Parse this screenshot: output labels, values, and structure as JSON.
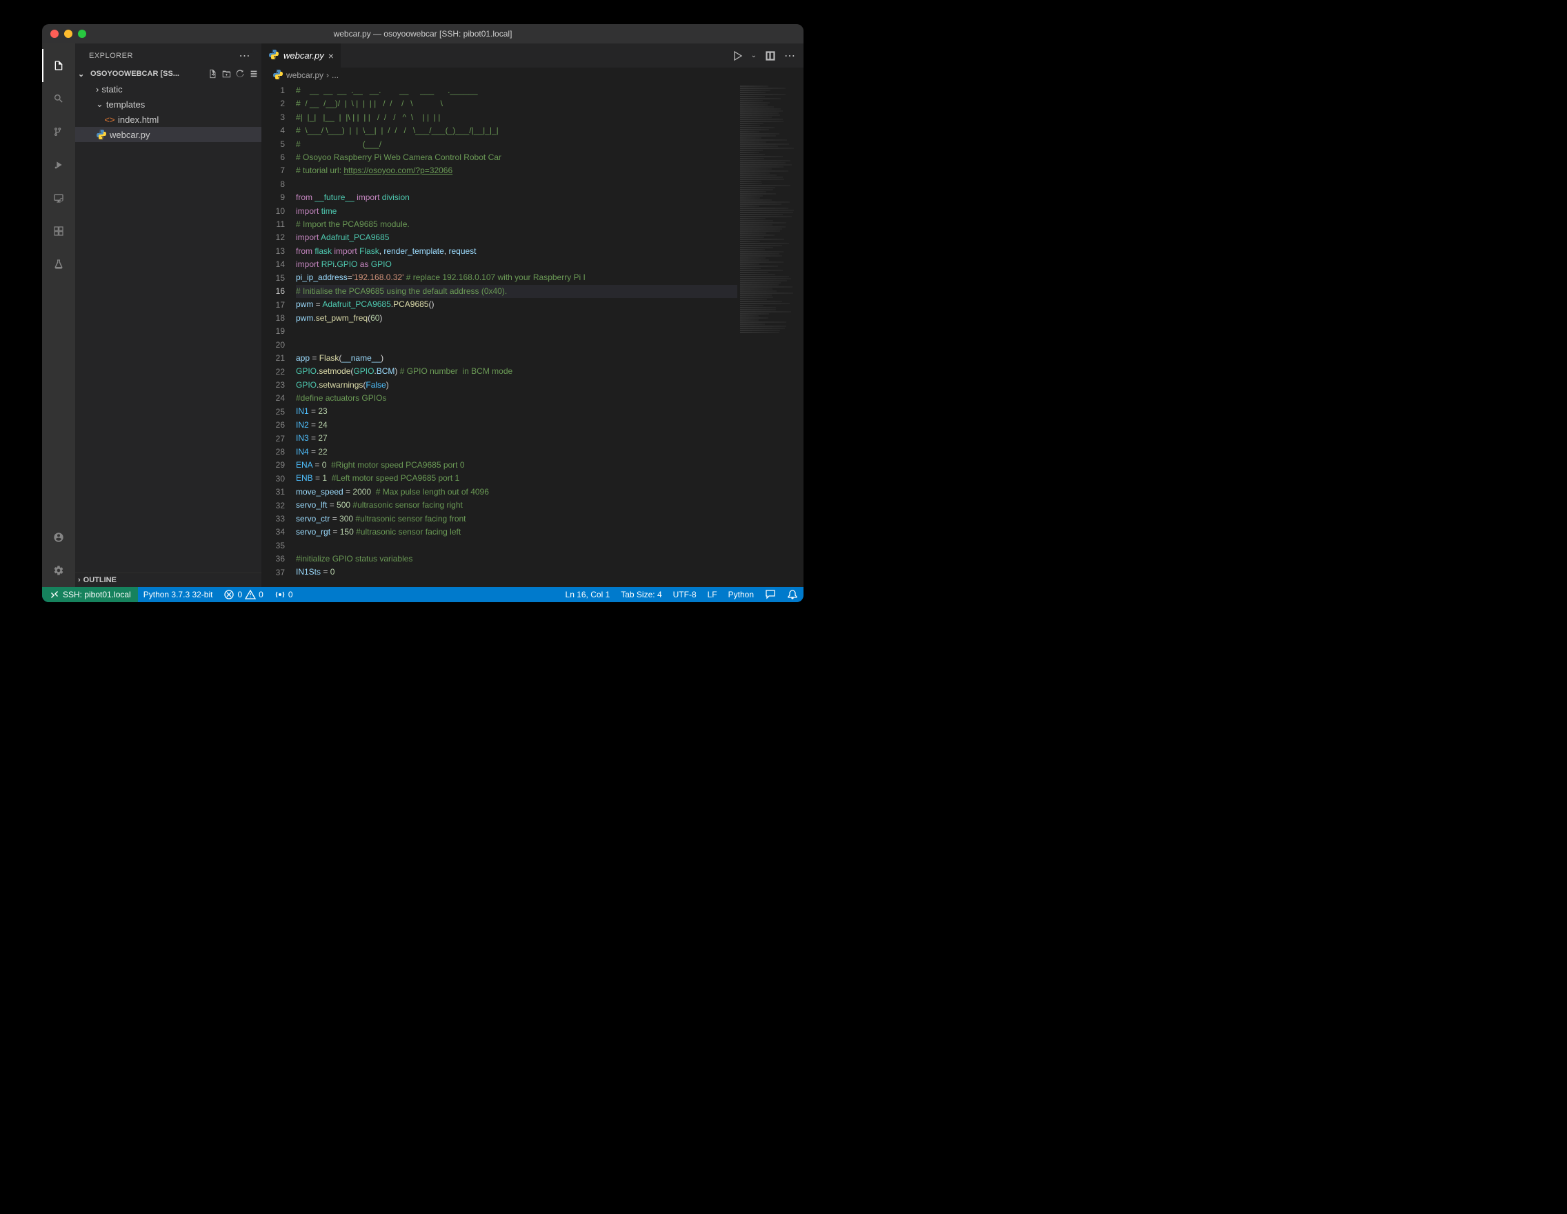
{
  "window": {
    "title": "webcar.py — osoyoowebcar [SSH: pibot01.local]"
  },
  "sidebar": {
    "header": "EXPLORER",
    "workspace": "OSOYOOWEBCAR [SS...",
    "tree": {
      "static": "static",
      "templates": "templates",
      "index_html": "index.html",
      "webcar_py": "webcar.py"
    },
    "outline": "OUTLINE"
  },
  "tabs": {
    "active": "webcar.py"
  },
  "breadcrumb": {
    "file": "webcar.py",
    "sep": "›",
    "more": "..."
  },
  "code": {
    "lines": [
      {
        "n": 1,
        "t": "comment",
        "text": "#    __  __  __  .__   __.        __     ___      .______"
      },
      {
        "n": 2,
        "t": "comment",
        "text": "#  / __  /__)/  |  \\ |  |  | |   /  /    /   \\            \\"
      },
      {
        "n": 3,
        "t": "comment",
        "text": "#|  |_|   |__  |  |\\ | |  | |   /  /   /   ^  \\    | |  | |"
      },
      {
        "n": 4,
        "t": "comment",
        "text": "#  \\___/ \\___)  |  |  \\__|  |  /  /   /   \\___/___(_)___/|__|_|_|"
      },
      {
        "n": 5,
        "t": "comment",
        "text": "#                           (___/"
      },
      {
        "n": 6,
        "t": "comment",
        "text": "# Osoyoo Raspberry Pi Web Camera Control Robot Car"
      },
      {
        "n": 7,
        "t": "mixed",
        "parts": [
          {
            "c": "c-comment",
            "t": "# tutorial url: "
          },
          {
            "c": "c-link",
            "t": "https://osoyoo.com/?p=32066"
          }
        ]
      },
      {
        "n": 8,
        "t": "blank",
        "text": ""
      },
      {
        "n": 9,
        "t": "mixed",
        "parts": [
          {
            "c": "c-keyword",
            "t": "from"
          },
          {
            "c": "c-op",
            "t": " "
          },
          {
            "c": "c-module",
            "t": "__future__"
          },
          {
            "c": "c-op",
            "t": " "
          },
          {
            "c": "c-keyword",
            "t": "import"
          },
          {
            "c": "c-op",
            "t": " "
          },
          {
            "c": "c-module",
            "t": "division"
          }
        ]
      },
      {
        "n": 10,
        "t": "mixed",
        "parts": [
          {
            "c": "c-keyword",
            "t": "import"
          },
          {
            "c": "c-op",
            "t": " "
          },
          {
            "c": "c-module",
            "t": "time"
          }
        ]
      },
      {
        "n": 11,
        "t": "comment",
        "text": "# Import the PCA9685 module."
      },
      {
        "n": 12,
        "t": "mixed",
        "parts": [
          {
            "c": "c-keyword",
            "t": "import"
          },
          {
            "c": "c-op",
            "t": " "
          },
          {
            "c": "c-module",
            "t": "Adafruit_PCA9685"
          }
        ]
      },
      {
        "n": 13,
        "t": "mixed",
        "parts": [
          {
            "c": "c-keyword",
            "t": "from"
          },
          {
            "c": "c-op",
            "t": " "
          },
          {
            "c": "c-module",
            "t": "flask"
          },
          {
            "c": "c-op",
            "t": " "
          },
          {
            "c": "c-keyword",
            "t": "import"
          },
          {
            "c": "c-op",
            "t": " "
          },
          {
            "c": "c-module",
            "t": "Flask"
          },
          {
            "c": "c-op",
            "t": ", "
          },
          {
            "c": "c-var",
            "t": "render_template"
          },
          {
            "c": "c-op",
            "t": ", "
          },
          {
            "c": "c-var",
            "t": "request"
          }
        ]
      },
      {
        "n": 14,
        "t": "mixed",
        "parts": [
          {
            "c": "c-keyword",
            "t": "import"
          },
          {
            "c": "c-op",
            "t": " "
          },
          {
            "c": "c-module",
            "t": "RPi"
          },
          {
            "c": "c-op",
            "t": "."
          },
          {
            "c": "c-module",
            "t": "GPIO"
          },
          {
            "c": "c-op",
            "t": " "
          },
          {
            "c": "c-keyword",
            "t": "as"
          },
          {
            "c": "c-op",
            "t": " "
          },
          {
            "c": "c-module",
            "t": "GPIO"
          }
        ]
      },
      {
        "n": 15,
        "t": "mixed",
        "parts": [
          {
            "c": "c-var",
            "t": "pi_ip_address"
          },
          {
            "c": "c-op",
            "t": "="
          },
          {
            "c": "c-string",
            "t": "'192.168.0.32'"
          },
          {
            "c": "c-op",
            "t": " "
          },
          {
            "c": "c-comment",
            "t": "# replace 192.168.0.107 with your Raspberry Pi I"
          }
        ]
      },
      {
        "n": 16,
        "t": "comment",
        "hl": true,
        "text": "# Initialise the PCA9685 using the default address (0x40)."
      },
      {
        "n": 17,
        "t": "mixed",
        "parts": [
          {
            "c": "c-var",
            "t": "pwm"
          },
          {
            "c": "c-op",
            "t": " = "
          },
          {
            "c": "c-module",
            "t": "Adafruit_PCA9685"
          },
          {
            "c": "c-op",
            "t": "."
          },
          {
            "c": "c-func",
            "t": "PCA9685"
          },
          {
            "c": "c-op",
            "t": "()"
          }
        ]
      },
      {
        "n": 18,
        "t": "mixed",
        "parts": [
          {
            "c": "c-var",
            "t": "pwm"
          },
          {
            "c": "c-op",
            "t": "."
          },
          {
            "c": "c-func",
            "t": "set_pwm_freq"
          },
          {
            "c": "c-op",
            "t": "("
          },
          {
            "c": "c-num",
            "t": "60"
          },
          {
            "c": "c-op",
            "t": ")"
          }
        ]
      },
      {
        "n": 19,
        "t": "blank",
        "text": ""
      },
      {
        "n": 20,
        "t": "blank",
        "text": ""
      },
      {
        "n": 21,
        "t": "mixed",
        "parts": [
          {
            "c": "c-var",
            "t": "app"
          },
          {
            "c": "c-op",
            "t": " = "
          },
          {
            "c": "c-func",
            "t": "Flask"
          },
          {
            "c": "c-op",
            "t": "("
          },
          {
            "c": "c-var",
            "t": "__name__"
          },
          {
            "c": "c-op",
            "t": ")"
          }
        ]
      },
      {
        "n": 22,
        "t": "mixed",
        "parts": [
          {
            "c": "c-module",
            "t": "GPIO"
          },
          {
            "c": "c-op",
            "t": "."
          },
          {
            "c": "c-func",
            "t": "setmode"
          },
          {
            "c": "c-op",
            "t": "("
          },
          {
            "c": "c-module",
            "t": "GPIO"
          },
          {
            "c": "c-op",
            "t": "."
          },
          {
            "c": "c-var",
            "t": "BCM"
          },
          {
            "c": "c-op",
            "t": ") "
          },
          {
            "c": "c-comment",
            "t": "# GPIO number  in BCM mode"
          }
        ]
      },
      {
        "n": 23,
        "t": "mixed",
        "parts": [
          {
            "c": "c-module",
            "t": "GPIO"
          },
          {
            "c": "c-op",
            "t": "."
          },
          {
            "c": "c-func",
            "t": "setwarnings"
          },
          {
            "c": "c-op",
            "t": "("
          },
          {
            "c": "c-const",
            "t": "False"
          },
          {
            "c": "c-op",
            "t": ")"
          }
        ]
      },
      {
        "n": 24,
        "t": "comment",
        "text": "#define actuators GPIOs"
      },
      {
        "n": 25,
        "t": "mixed",
        "parts": [
          {
            "c": "c-const",
            "t": "IN1"
          },
          {
            "c": "c-op",
            "t": " = "
          },
          {
            "c": "c-num",
            "t": "23"
          }
        ]
      },
      {
        "n": 26,
        "t": "mixed",
        "parts": [
          {
            "c": "c-const",
            "t": "IN2"
          },
          {
            "c": "c-op",
            "t": " = "
          },
          {
            "c": "c-num",
            "t": "24"
          }
        ]
      },
      {
        "n": 27,
        "t": "mixed",
        "parts": [
          {
            "c": "c-const",
            "t": "IN3"
          },
          {
            "c": "c-op",
            "t": " = "
          },
          {
            "c": "c-num",
            "t": "27"
          }
        ]
      },
      {
        "n": 28,
        "t": "mixed",
        "parts": [
          {
            "c": "c-const",
            "t": "IN4"
          },
          {
            "c": "c-op",
            "t": " = "
          },
          {
            "c": "c-num",
            "t": "22"
          }
        ]
      },
      {
        "n": 29,
        "t": "mixed",
        "parts": [
          {
            "c": "c-const",
            "t": "ENA"
          },
          {
            "c": "c-op",
            "t": " = "
          },
          {
            "c": "c-num",
            "t": "0"
          },
          {
            "c": "c-op",
            "t": "  "
          },
          {
            "c": "c-comment",
            "t": "#Right motor speed PCA9685 port 0"
          }
        ]
      },
      {
        "n": 30,
        "t": "mixed",
        "parts": [
          {
            "c": "c-const",
            "t": "ENB"
          },
          {
            "c": "c-op",
            "t": " = "
          },
          {
            "c": "c-num",
            "t": "1"
          },
          {
            "c": "c-op",
            "t": "  "
          },
          {
            "c": "c-comment",
            "t": "#Left motor speed PCA9685 port 1"
          }
        ]
      },
      {
        "n": 31,
        "t": "mixed",
        "parts": [
          {
            "c": "c-var",
            "t": "move_speed"
          },
          {
            "c": "c-op",
            "t": " = "
          },
          {
            "c": "c-num",
            "t": "2000"
          },
          {
            "c": "c-op",
            "t": "  "
          },
          {
            "c": "c-comment",
            "t": "# Max pulse length out of 4096"
          }
        ]
      },
      {
        "n": 32,
        "t": "mixed",
        "parts": [
          {
            "c": "c-var",
            "t": "servo_lft"
          },
          {
            "c": "c-op",
            "t": " = "
          },
          {
            "c": "c-num",
            "t": "500"
          },
          {
            "c": "c-op",
            "t": " "
          },
          {
            "c": "c-comment",
            "t": "#ultrasonic sensor facing right"
          }
        ]
      },
      {
        "n": 33,
        "t": "mixed",
        "parts": [
          {
            "c": "c-var",
            "t": "servo_ctr"
          },
          {
            "c": "c-op",
            "t": " = "
          },
          {
            "c": "c-num",
            "t": "300"
          },
          {
            "c": "c-op",
            "t": " "
          },
          {
            "c": "c-comment",
            "t": "#ultrasonic sensor facing front"
          }
        ]
      },
      {
        "n": 34,
        "t": "mixed",
        "parts": [
          {
            "c": "c-var",
            "t": "servo_rgt"
          },
          {
            "c": "c-op",
            "t": " = "
          },
          {
            "c": "c-num",
            "t": "150"
          },
          {
            "c": "c-op",
            "t": " "
          },
          {
            "c": "c-comment",
            "t": "#ultrasonic sensor facing left"
          }
        ]
      },
      {
        "n": 35,
        "t": "blank",
        "text": ""
      },
      {
        "n": 36,
        "t": "comment",
        "text": "#initialize GPIO status variables"
      },
      {
        "n": 37,
        "t": "mixed",
        "parts": [
          {
            "c": "c-var",
            "t": "IN1Sts"
          },
          {
            "c": "c-op",
            "t": " = "
          },
          {
            "c": "c-num",
            "t": "0"
          }
        ]
      }
    ]
  },
  "statusbar": {
    "remote": "SSH: pibot01.local",
    "python": "Python 3.7.3 32-bit",
    "errors": "0",
    "warnings": "0",
    "broadcast": "0",
    "cursor": "Ln 16, Col 1",
    "tabsize": "Tab Size: 4",
    "encoding": "UTF-8",
    "eol": "LF",
    "language": "Python"
  }
}
